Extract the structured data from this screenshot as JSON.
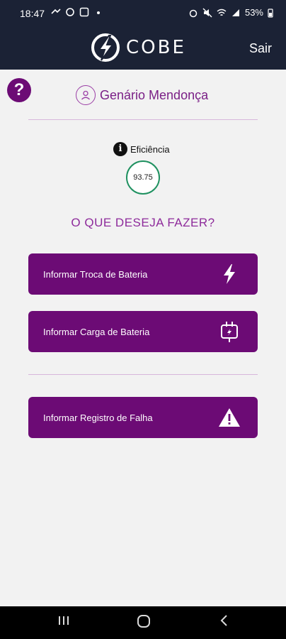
{
  "status_bar": {
    "time": "18:47",
    "battery": "53%"
  },
  "header": {
    "app_name": "COBE",
    "logout_label": "Sair"
  },
  "help": {
    "label": "?"
  },
  "user": {
    "name": "Genário Mendonça"
  },
  "efficiency": {
    "label": "Eficiência",
    "value": "93.75"
  },
  "prompt": {
    "title": "O QUE DESEJA FAZER?"
  },
  "actions": [
    {
      "label": "Informar Troca de Bateria",
      "icon": "bolt-icon"
    },
    {
      "label": "Informar Carga de Bateria",
      "icon": "plug-icon"
    },
    {
      "label": "Informar Registro de Falha",
      "icon": "warning-icon"
    }
  ],
  "colors": {
    "header_bg": "#1b2235",
    "brand_purple": "#6c0b75",
    "efficiency_ring": "#1f9160"
  }
}
